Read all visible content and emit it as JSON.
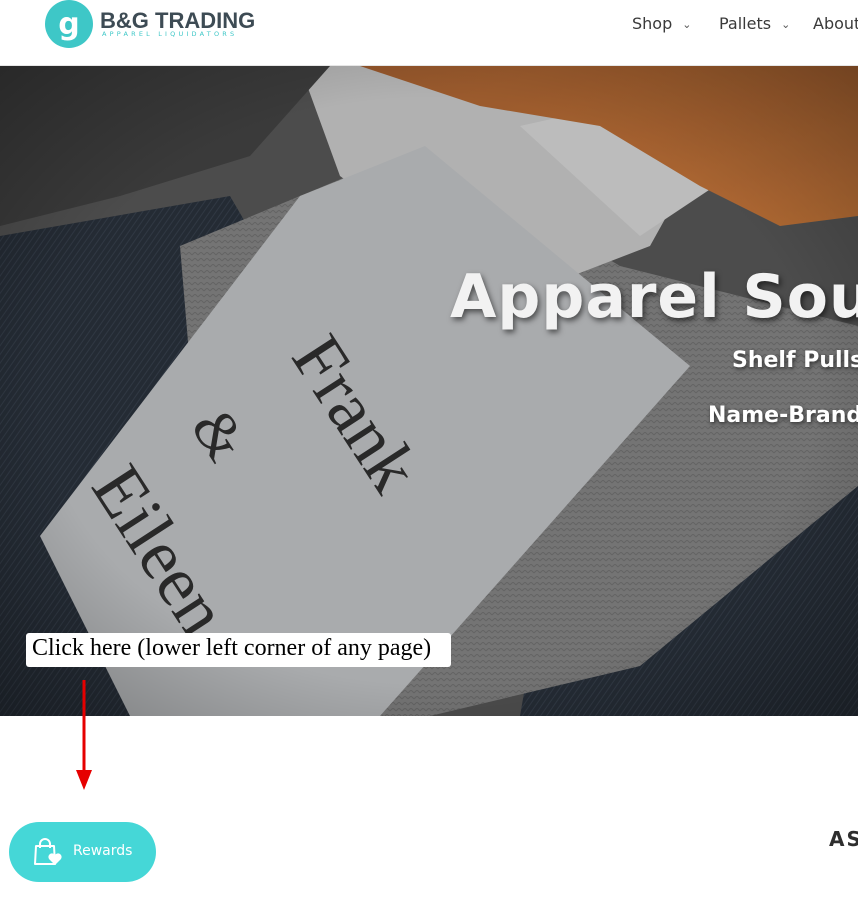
{
  "brand": {
    "logo_letter": "g",
    "name": "B&G TRADING",
    "tagline": "APPAREL LIQUIDATORS",
    "colors": {
      "teal": "#3ec7c7",
      "dark": "#3d4b54"
    }
  },
  "nav": {
    "items": [
      {
        "label": "Shop",
        "icon": "chevron-down-icon"
      },
      {
        "label": "Pallets",
        "icon": "chevron-down-icon"
      },
      {
        "label": "About"
      }
    ]
  },
  "hero": {
    "title": "Apparel Sour",
    "subtitle_1": "Shelf Pulls",
    "subtitle_2": "Name-Brand",
    "tag_text": "Frank & Eileen",
    "callout": "Click here (lower left corner of any page)"
  },
  "section": {
    "label": "AS"
  },
  "rewards": {
    "label": "Rewards",
    "icon": "shopping-bag-heart-icon",
    "color": "#45d7d7"
  },
  "annotation": {
    "arrow_color": "#e60000"
  }
}
